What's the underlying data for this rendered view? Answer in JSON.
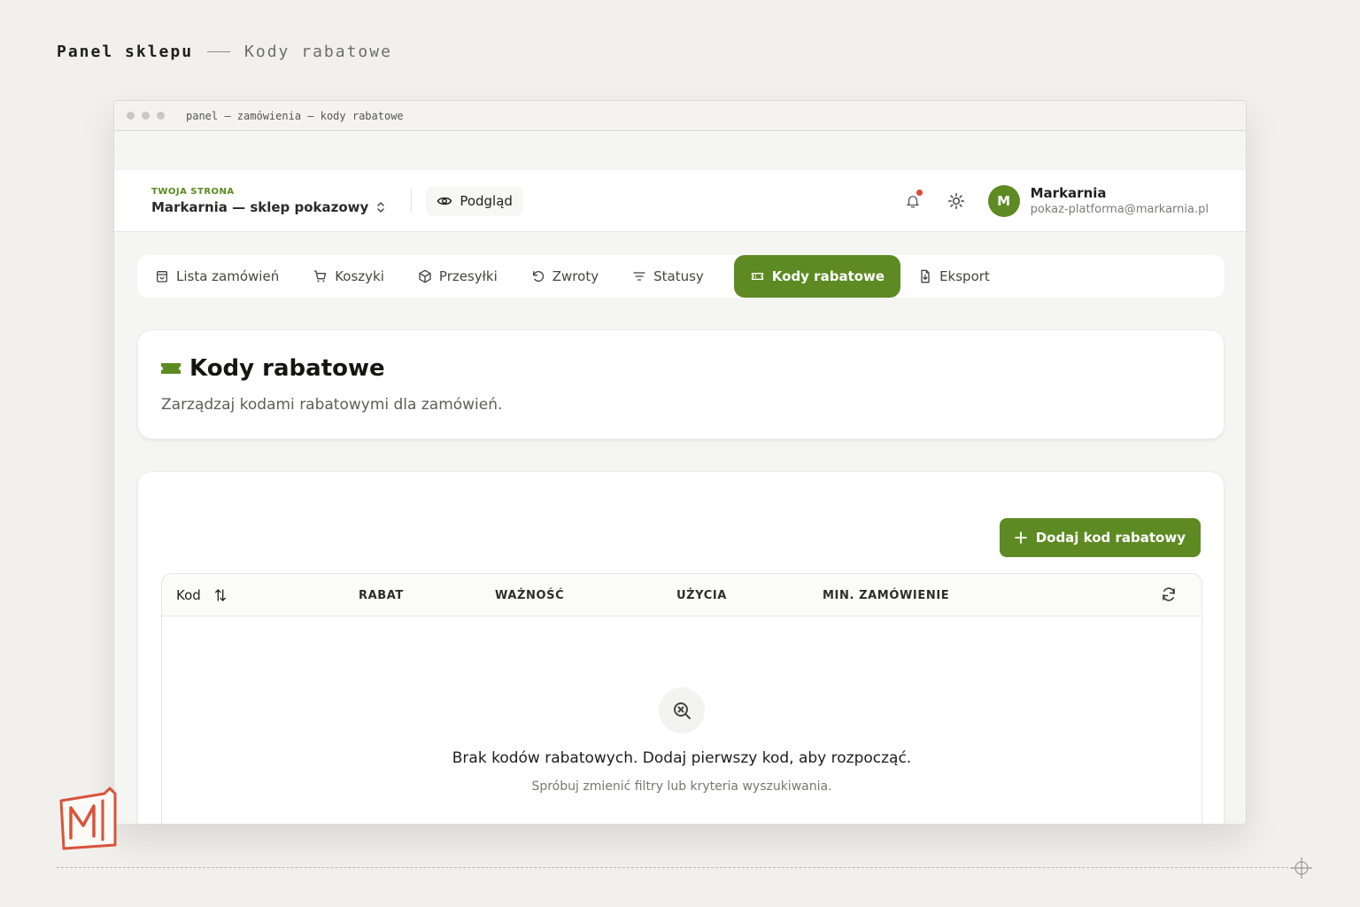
{
  "page_heading": {
    "title": "Panel sklepu",
    "subtitle": "Kody rabatowe"
  },
  "window": {
    "path": "panel — zamówienia — kody rabatowe"
  },
  "header": {
    "store_kicker": "TWOJA STRONA",
    "store_name": "Markarnia — sklep pokazowy",
    "preview_label": "Podgląd",
    "user_initial": "M",
    "user_name": "Markarnia",
    "user_email": "pokaz-platforma@markarnia.pl"
  },
  "tabs": [
    {
      "label": "Lista zamówień",
      "icon": "bag-icon"
    },
    {
      "label": "Koszyki",
      "icon": "cart-icon"
    },
    {
      "label": "Przesyłki",
      "icon": "package-icon"
    },
    {
      "label": "Zwroty",
      "icon": "undo-icon"
    },
    {
      "label": "Statusy",
      "icon": "filter-icon"
    },
    {
      "label": "Kody rabatowe",
      "icon": "ticket-icon",
      "active": true
    },
    {
      "label": "Eksport",
      "icon": "file-export-icon"
    }
  ],
  "section": {
    "title": "Kody rabatowe",
    "description": "Zarządzaj kodami rabatowymi dla zamówień."
  },
  "list": {
    "add_button": "Dodaj kod rabatowy",
    "columns": [
      "Kod",
      "RABAT",
      "WAŻNOŚĆ",
      "UŻYCIA",
      "MIN. ZAMÓWIENIE"
    ],
    "empty_title": "Brak kodów rabatowych. Dodaj pierwszy kod, aby rozpocząć.",
    "empty_hint": "Spróbuj zmienić filtry lub kryteria wyszukiwania."
  },
  "colors": {
    "accent": "#5d8a22",
    "badge": "#e0463b",
    "logo": "#d9533a"
  }
}
